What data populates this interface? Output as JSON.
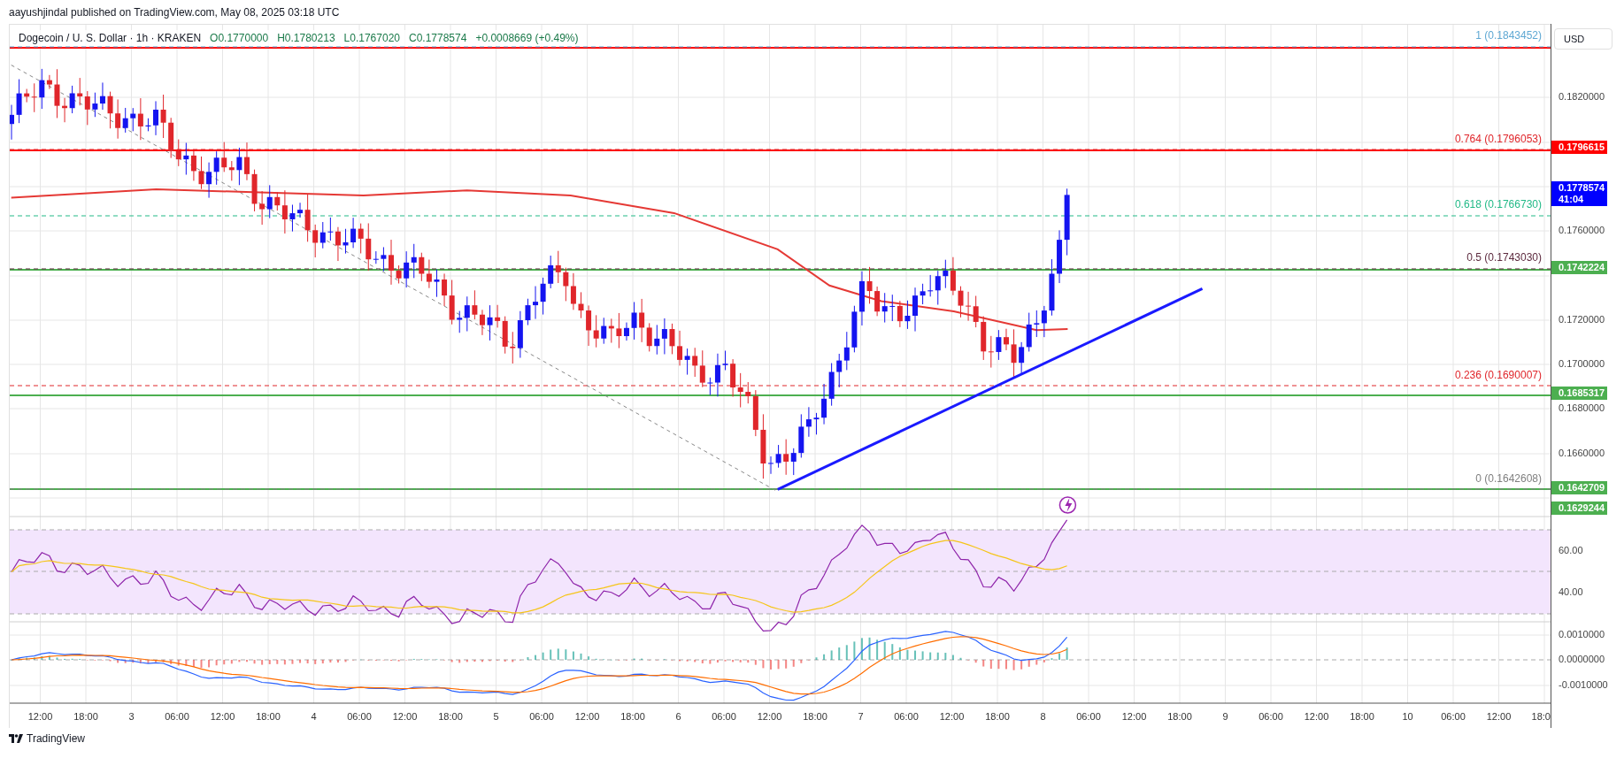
{
  "byline": "aayushjindal published on TradingView.com, May 08, 2025 03:18 UTC",
  "legend": {
    "symbol": "Dogecoin / U. S. Dollar · 1h · KRAKEN",
    "values": [
      {
        "label": "O",
        "value": "0.1770000"
      },
      {
        "label": "H",
        "value": "0.1780213"
      },
      {
        "label": "L",
        "value": "0.1767020"
      },
      {
        "label": "C",
        "value": "0.1778574"
      }
    ],
    "change": "+0.0008669 (+0.49%)"
  },
  "currency": "USD",
  "fib_levels": [
    {
      "label": "1 (0.1843452)",
      "color": "#5fa8d3"
    },
    {
      "label": "0.764 (0.1796053)",
      "color": "#e0262b"
    },
    {
      "label": "0.618 (0.1766730)",
      "color": "#22b987"
    },
    {
      "label": "0.5 (0.1743030)",
      "color": "#5d2b3f"
    },
    {
      "label": "0.236 (0.1690007)",
      "color": "#e0262b"
    },
    {
      "label": "0 (0.1642608)",
      "color": "#808080"
    }
  ],
  "price_scale": [
    "0.1820000",
    "0.1760000",
    "0.1720000",
    "0.1700000",
    "0.1680000",
    "0.1660000"
  ],
  "price_tags": [
    {
      "lines": [
        "0.1796615"
      ],
      "color": "#ff0000"
    },
    {
      "lines": [
        "0.1778574",
        "41:04"
      ],
      "color": "#0000ff"
    },
    {
      "lines": [
        "0.1742224"
      ],
      "color": "#4caf50"
    },
    {
      "lines": [
        "0.1685317"
      ],
      "color": "#4caf50"
    },
    {
      "lines": [
        "0.1642709"
      ],
      "color": "#4caf50"
    },
    {
      "lines": [
        "0.1629244"
      ],
      "color": "#4caf50"
    }
  ],
  "rsi_scale": [
    "60.00",
    "40.00"
  ],
  "macd_scale": [
    "0.0010000",
    "0.0000000",
    "-0.0010000"
  ],
  "time_axis": [
    "12:00",
    "18:00",
    "3",
    "06:00",
    "12:00",
    "18:00",
    "4",
    "06:00",
    "12:00",
    "18:00",
    "5",
    "06:00",
    "12:00",
    "18:00",
    "6",
    "06:00",
    "12:00",
    "18:00",
    "7",
    "06:00",
    "12:00",
    "18:00",
    "8",
    "06:00",
    "12:00",
    "18:00",
    "9",
    "06:00",
    "12:00",
    "18:00",
    "10",
    "06:00",
    "12:00",
    "18:0"
  ],
  "footer": {
    "brand": "TradingView"
  }
}
